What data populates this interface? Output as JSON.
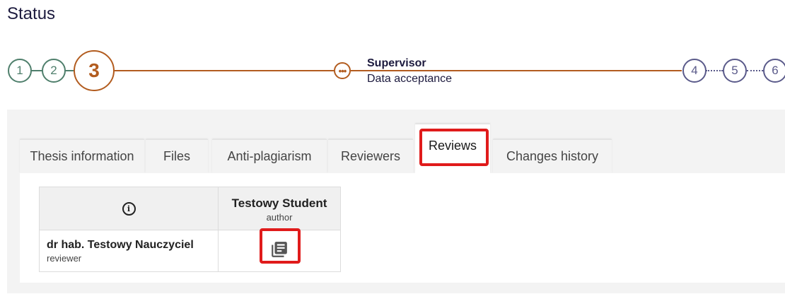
{
  "page": {
    "title": "Status"
  },
  "stepper": {
    "completed_steps": [
      "1",
      "2"
    ],
    "current_step": "3",
    "substep_icon": "more-horiz-icon",
    "substep": {
      "role": "Supervisor",
      "description": "Data acceptance"
    },
    "future_steps": [
      "4",
      "5",
      "6"
    ]
  },
  "tabs": [
    {
      "label": "Thesis information"
    },
    {
      "label": "Files"
    },
    {
      "label": "Anti-plagiarism"
    },
    {
      "label": "Reviewers"
    },
    {
      "label": "Reviews",
      "active": true
    },
    {
      "label": "Changes history"
    }
  ],
  "reviews_table": {
    "header_icon": "info-icon",
    "student": {
      "name": "Testowy Student",
      "role": "author"
    },
    "rows": [
      {
        "reviewer_name": "dr hab. Testowy Nauczyciel",
        "reviewer_role": "reviewer",
        "review_icon": "review-document-icon"
      }
    ]
  },
  "colors": {
    "completed": "#4f7f6c",
    "current": "#b25c1f",
    "future": "#5a5a8a",
    "highlight": "#e01b1b"
  }
}
